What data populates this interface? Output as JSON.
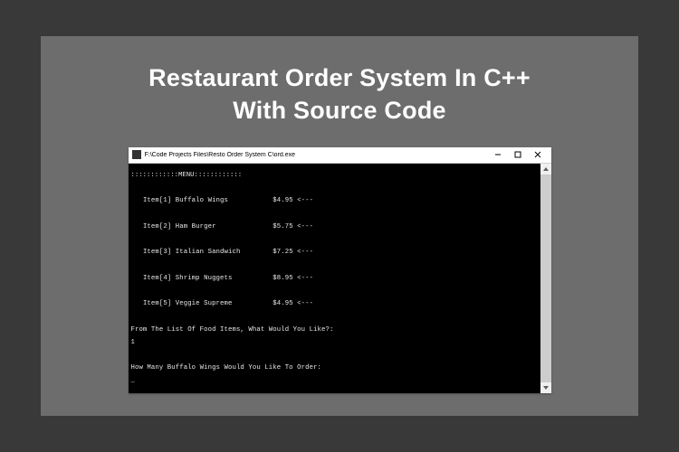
{
  "headline": {
    "line1": "Restaurant Order System In C++",
    "line2": "With Source Code"
  },
  "window": {
    "title": "F:\\Code Projects Files\\Resto Order System C\\ord.exe",
    "controls": {
      "minimize": "minimize",
      "maximize": "maximize",
      "close": "close"
    }
  },
  "console": {
    "header": "::::::::::::MENU::::::::::::",
    "items": [
      {
        "label": "Item[1] Buffalo Wings",
        "price": "$4.95",
        "arrow": "<---"
      },
      {
        "label": "Item[2] Ham Burger",
        "price": "$5.75",
        "arrow": "<---"
      },
      {
        "label": "Item[3] Italian Sandwich",
        "price": "$7.25",
        "arrow": "<---"
      },
      {
        "label": "Item[4] Shrimp Nuggets",
        "price": "$8.95",
        "arrow": "<---"
      },
      {
        "label": "Item[5] Veggie Supreme",
        "price": "$4.95",
        "arrow": "<---"
      }
    ],
    "prompt1": "From The List Of Food Items, What Would You Like?:",
    "input1": "1",
    "prompt2": "How Many Buffalo Wings Would You Like To Order:",
    "cursor": "_"
  }
}
